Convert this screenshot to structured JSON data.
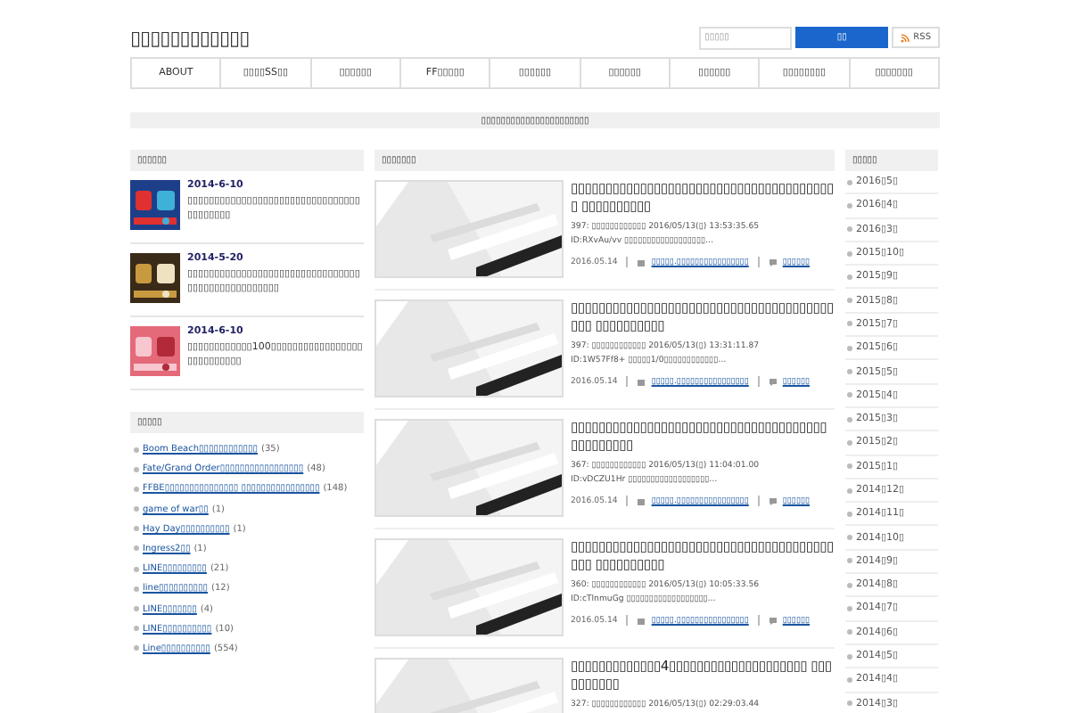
{
  "site_title": "▯▯▯▯▯▯▯▯▯▯▯▯",
  "search": {
    "placeholder": "▯▯▯▯▯",
    "button": "▯▯"
  },
  "rss": "RSS",
  "nav": [
    "ABOUT",
    "▯▯▯▯SS▯▯",
    "▯▯▯▯▯▯",
    "FF▯▯▯▯▯",
    "▯▯▯▯▯▯",
    "▯▯▯▯▯▯",
    "▯▯▯▯▯▯",
    "▯▯▯▯▯▯▯▯",
    "▯▯▯▯▯▯▯"
  ],
  "notice": "▯▯▯▯▯▯▯▯▯▯▯▯▯▯▯▯▯▯▯▯▯▯",
  "popular": {
    "heading": "▯▯▯▯▯▯",
    "items": [
      {
        "date": "2014-6-10",
        "title": "▯▯▯▯▯▯▯▯▯▯▯▯▯▯▯▯▯▯▯▯▯▯▯▯▯▯▯▯▯▯▯▯▯▯▯▯▯▯▯▯"
      },
      {
        "date": "2014-5-20",
        "title": "▯▯▯▯▯▯▯▯▯▯▯▯▯▯▯▯▯▯▯▯▯▯▯▯▯▯▯▯▯▯▯▯▯▯▯▯▯▯▯▯▯▯▯▯▯▯▯▯▯"
      },
      {
        "date": "2014-6-10",
        "title": "▯▯▯▯▯▯▯▯▯▯▯▯100▯▯▯▯▯▯▯▯▯▯▯▯▯▯▯▯▯▯▯▯▯▯▯▯▯▯▯"
      }
    ]
  },
  "categories": {
    "heading": "▯▯▯▯▯",
    "items": [
      {
        "name": "Boom Beach▯▯▯▯▯▯▯▯▯▯▯▯",
        "count": "(35)"
      },
      {
        "name": "Fate/Grand Order▯▯▯▯▯▯▯▯▯▯▯▯▯▯▯▯▯",
        "count": "(48)"
      },
      {
        "name": "FFBE▯▯▯▯▯▯▯▯▯▯▯▯▯▯▯ ▯▯▯▯▯▯▯▯▯▯▯▯▯▯▯▯",
        "count": "(148)"
      },
      {
        "name": "game of war▯▯",
        "count": "(1)"
      },
      {
        "name": "Hay Day▯▯▯▯▯▯▯▯▯▯",
        "count": "(1)"
      },
      {
        "name": "Ingress2▯▯",
        "count": "(1)"
      },
      {
        "name": "LINE▯▯▯▯▯▯▯▯▯",
        "count": "(21)"
      },
      {
        "name": "line▯▯▯▯▯▯▯▯▯▯",
        "count": "(12)"
      },
      {
        "name": "LINE▯▯▯▯▯▯▯",
        "count": "(4)"
      },
      {
        "name": "LINE▯▯▯▯▯▯▯▯▯▯",
        "count": "(10)"
      },
      {
        "name": "Line▯▯▯▯▯▯▯▯▯▯",
        "count": "(554)"
      }
    ]
  },
  "articles": {
    "heading": "▯▯▯▯▯▯▯",
    "items": [
      {
        "title": "▯▯▯▯▯▯▯▯▯▯▯▯▯▯▯▯▯▯▯▯▯▯▯▯▯▯▯▯▯▯▯▯▯▯▯▯▯▯▯ ▯▯▯▯▯▯▯▯▯▯",
        "lines": [
          "397: ▯▯▯▯▯▯▯▯▯▯▯▯ 2016/05/13(▯) 13:53:35.65",
          "ID:RXvAu/vv ▯▯▯▯▯▯▯▯▯▯▯▯▯▯▯▯▯▯…"
        ],
        "date": "2016.05.14",
        "category": "▯▯▯▯▯.▯▯▯▯▯▯▯▯▯▯▯▯▯▯▯▯",
        "comments": "▯▯▯▯▯▯"
      },
      {
        "title": "▯▯▯▯▯▯▯▯▯▯▯▯▯▯▯▯▯▯▯▯▯▯▯▯▯▯▯▯▯▯▯▯▯▯▯▯▯▯▯▯▯ ▯▯▯▯▯▯▯▯▯▯",
        "lines": [
          "397: ▯▯▯▯▯▯▯▯▯▯▯▯ 2016/05/13(▯) 13:31:11.87",
          "ID:1W57Ff8+ ▯▯▯▯▯1/0▯▯▯▯▯▯▯▯▯▯▯▯…"
        ],
        "date": "2016.05.14",
        "category": "▯▯▯▯▯.▯▯▯▯▯▯▯▯▯▯▯▯▯▯▯▯",
        "comments": "▯▯▯▯▯▯"
      },
      {
        "title": "▯▯▯▯▯▯▯▯▯▯▯▯▯▯▯▯▯▯▯▯▯▯▯▯▯▯▯▯▯▯▯▯▯▯▯▯▯ ▯▯▯▯▯▯▯▯▯",
        "lines": [
          "367: ▯▯▯▯▯▯▯▯▯▯▯▯ 2016/05/13(▯) 11:04:01.00",
          "ID:vDCZU1Hr ▯▯▯▯▯▯▯▯▯▯▯▯▯▯▯▯▯▯…"
        ],
        "date": "2016.05.14",
        "category": "▯▯▯▯▯.▯▯▯▯▯▯▯▯▯▯▯▯▯▯▯▯",
        "comments": "▯▯▯▯▯▯"
      },
      {
        "title": "▯▯▯▯▯▯▯▯▯▯▯▯▯▯▯▯▯▯▯▯▯▯▯▯▯▯▯▯▯▯▯▯▯▯▯▯▯▯▯▯▯ ▯▯▯▯▯▯▯▯▯▯",
        "lines": [
          "360: ▯▯▯▯▯▯▯▯▯▯▯▯ 2016/05/13(▯) 10:05:33.56",
          "ID:cTlnmuGg ▯▯▯▯▯▯▯▯▯▯▯▯▯▯▯▯▯▯…"
        ],
        "date": "2016.05.14",
        "category": "▯▯▯▯▯.▯▯▯▯▯▯▯▯▯▯▯▯▯▯▯▯",
        "comments": "▯▯▯▯▯▯"
      },
      {
        "title": "▯▯▯▯▯▯▯▯▯▯▯▯▯4▯▯▯▯▯▯▯▯▯▯▯▯▯▯▯▯▯▯▯▯ ▯▯▯▯▯▯▯▯▯▯",
        "lines": [
          "327: ▯▯▯▯▯▯▯▯▯▯▯▯ 2016/05/13(▯) 02:29:03.44"
        ]
      }
    ]
  },
  "archives": {
    "heading": "▯▯▯▯▯",
    "items": [
      "2016▯5▯",
      "2016▯4▯",
      "2016▯3▯",
      "2015▯10▯",
      "2015▯9▯",
      "2015▯8▯",
      "2015▯7▯",
      "2015▯6▯",
      "2015▯5▯",
      "2015▯4▯",
      "2015▯3▯",
      "2015▯2▯",
      "2015▯1▯",
      "2014▯12▯",
      "2014▯11▯",
      "2014▯10▯",
      "2014▯9▯",
      "2014▯8▯",
      "2014▯7▯",
      "2014▯6▯",
      "2014▯5▯",
      "2014▯4▯",
      "2014▯3▯"
    ]
  }
}
